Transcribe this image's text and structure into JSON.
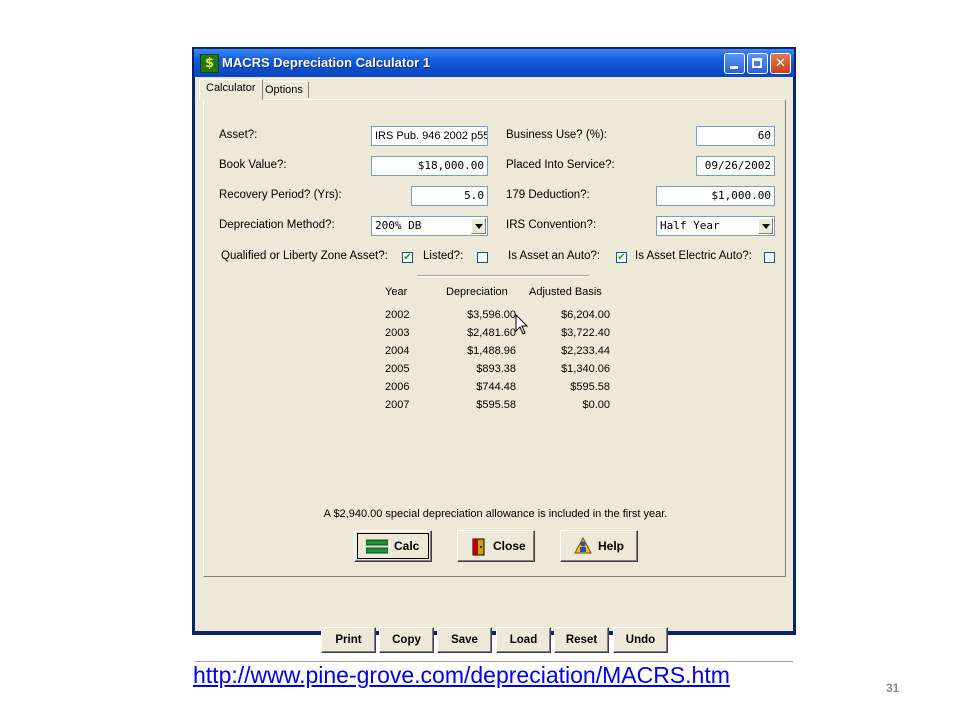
{
  "window": {
    "title": "MACRS Depreciation Calculator 1"
  },
  "tabs": [
    {
      "label": "Calculator"
    },
    {
      "label": "Options"
    }
  ],
  "form": {
    "asset_label": "Asset?:",
    "asset_value": "IRS Pub. 946 2002 p55",
    "book_value_label": "Book Value?:",
    "book_value": "$18,000.00",
    "recovery_label": "Recovery Period? (Yrs):",
    "recovery_value": "5.0",
    "method_label": "Depreciation Method?:",
    "method_value": "200% DB",
    "business_use_label": "Business Use? (%):",
    "business_use_value": "60",
    "placed_label": "Placed Into Service?:",
    "placed_value": "09/26/2002",
    "deduction_label": "179 Deduction?:",
    "deduction_value": "$1,000.00",
    "convention_label": "IRS Convention?:",
    "convention_value": "Half Year"
  },
  "checks": [
    {
      "label": "Qualified or Liberty Zone Asset?:",
      "checked": true
    },
    {
      "label": "Listed?:",
      "checked": false
    },
    {
      "label": "Is Asset an Auto?:",
      "checked": true
    },
    {
      "label": "Is Asset Electric Auto?:",
      "checked": false
    }
  ],
  "table": {
    "headers": [
      "Year",
      "Depreciation",
      "Adjusted Basis"
    ],
    "rows": [
      [
        "2002",
        "$3,596.00",
        "$6,204.00"
      ],
      [
        "2003",
        "$2,481.60",
        "$3,722.40"
      ],
      [
        "2004",
        "$1,488.96",
        "$2,233.44"
      ],
      [
        "2005",
        "$893.38",
        "$1,340.06"
      ],
      [
        "2006",
        "$744.48",
        "$595.58"
      ],
      [
        "2007",
        "$595.58",
        "$0.00"
      ]
    ]
  },
  "note": "A $2,940.00 special depreciation allowance is included in the first year.",
  "main_buttons": {
    "calc": "Calc",
    "close": "Close",
    "help": "Help"
  },
  "bottom_buttons": {
    "print": "Print",
    "copy": "Copy",
    "save": "Save",
    "load": "Load",
    "reset": "Reset",
    "undo": "Undo"
  },
  "footer": {
    "url": "http://www.pine-grove.com/depreciation/MACRS.htm",
    "page_number": "31"
  }
}
